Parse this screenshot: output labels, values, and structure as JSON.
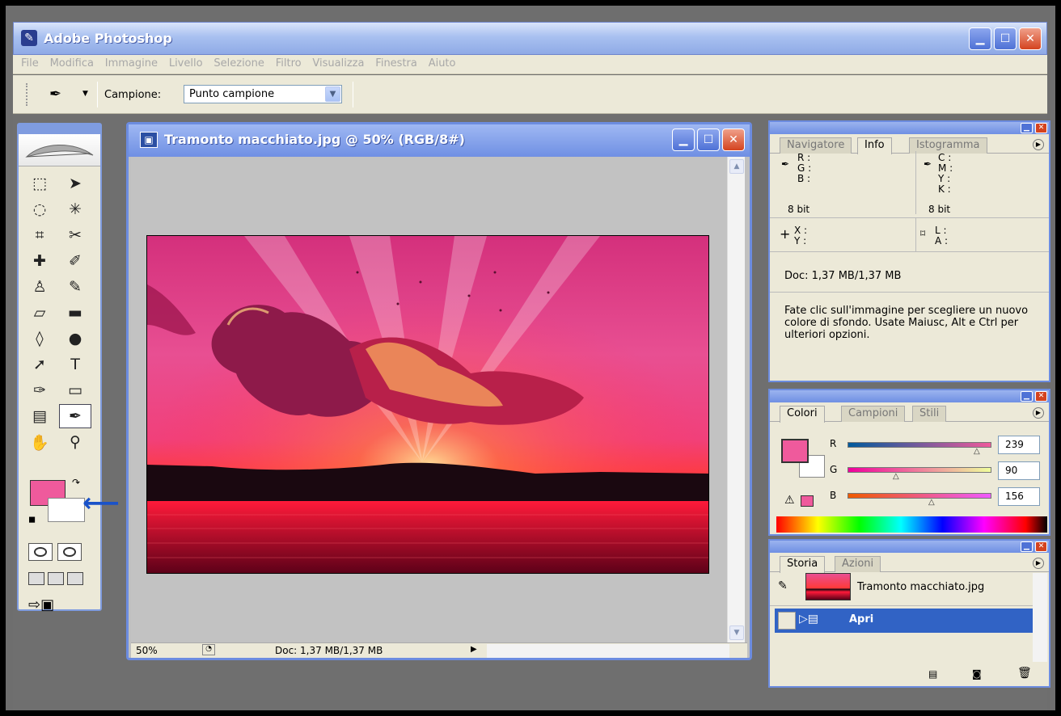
{
  "app": {
    "title": "Adobe Photoshop"
  },
  "menu": [
    "File",
    "Modifica",
    "Immagine",
    "Livello",
    "Selezione",
    "Filtro",
    "Visualizza",
    "Finestra",
    "Aiuto"
  ],
  "options": {
    "campione_label": "Campione:",
    "campione_value": "Punto campione"
  },
  "colors": {
    "foreground": "#ef5a9c",
    "background": "#ffffff",
    "accent": "#6c8ce0",
    "selection": "#3163c5"
  },
  "document": {
    "title": "Tramonto macchiato.jpg @ 50% (RGB/8#)",
    "zoom": "50%",
    "doc_size": "Doc: 1,37 MB/1,37 MB"
  },
  "info_panel": {
    "tabs": [
      "Navigatore",
      "Info",
      "Istogramma"
    ],
    "active_tab": "Info",
    "rgb_labels": "R :\nG :\nB :",
    "cmyk_labels": "C :\nM :\nY :\nK :",
    "bit_left": "8 bit",
    "bit_right": "8 bit",
    "xy": "X :\nY :",
    "la": "L :\nA :",
    "doc": "Doc: 1,37 MB/1,37 MB",
    "help": "Fate clic sull'immagine per scegliere un nuovo colore di sfondo. Usate Maiusc, Alt e Ctrl per ulteriori opzioni."
  },
  "color_panel": {
    "tabs": [
      "Colori",
      "Campioni",
      "Stili"
    ],
    "active_tab": "Colori",
    "r_label": "R",
    "g_label": "G",
    "b_label": "B",
    "r": 239,
    "g": 90,
    "b": 156
  },
  "history_panel": {
    "tabs": [
      "Storia",
      "Azioni"
    ],
    "active_tab": "Storia",
    "snapshot": "Tramonto macchiato.jpg",
    "items": [
      "Apri"
    ]
  }
}
